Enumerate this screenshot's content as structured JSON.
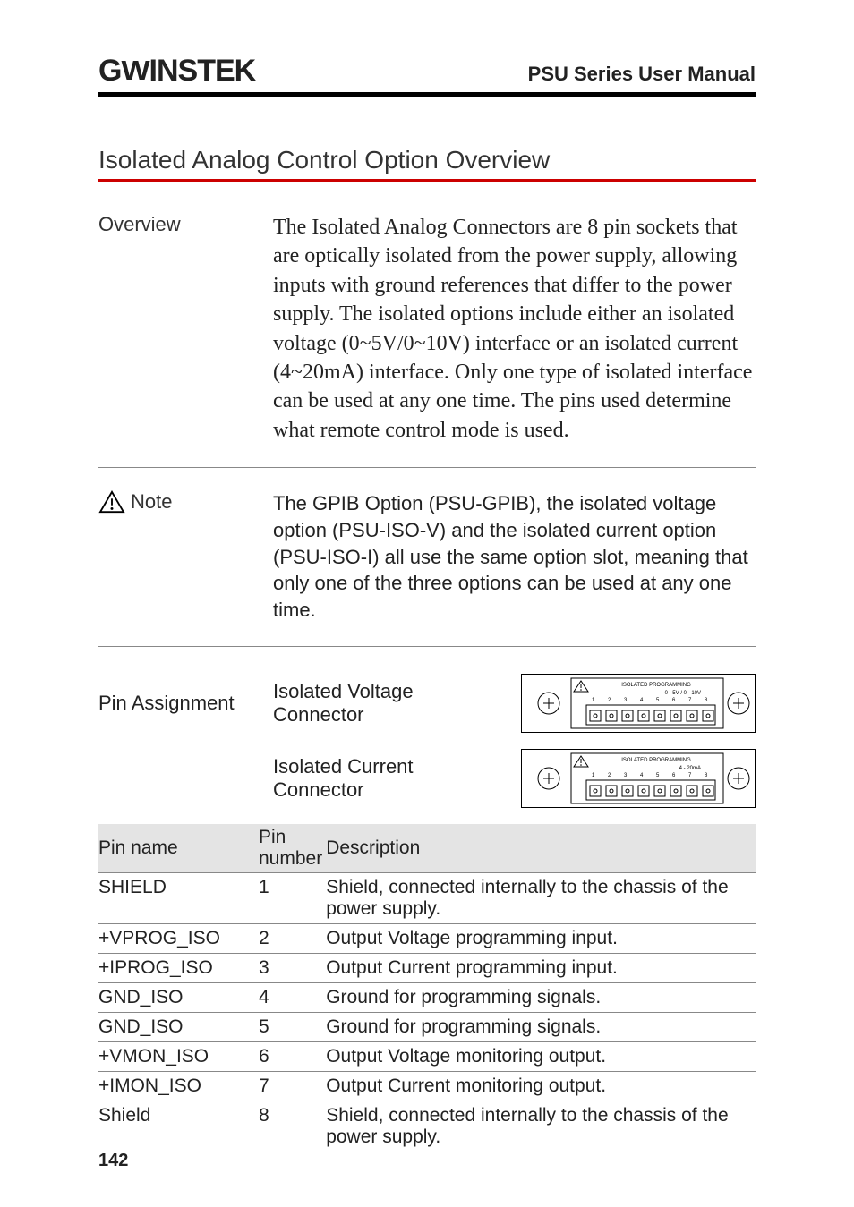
{
  "header": {
    "brand": "GWINSTEK",
    "doc_title": "PSU Series User Manual"
  },
  "section_title": "Isolated Analog Control Option Overview",
  "overview": {
    "label": "Overview",
    "text": "The Isolated Analog Connectors are 8 pin sockets that are optically isolated from the power supply, allowing inputs with ground references that differ to the power supply. The isolated options include either an isolated voltage (0~5V/0~10V) interface or an isolated current (4~20mA) interface. Only one type of isolated interface can be used at any one time. The pins used determine what remote control mode is used."
  },
  "note": {
    "label": "Note",
    "text": "The GPIB Option (PSU-GPIB), the isolated voltage option (PSU-ISO-V) and the isolated current option (PSU-ISO-I) all use the same option slot, meaning that only one of the three options can be used at any one time."
  },
  "pin_assignment": {
    "label": "Pin Assignment",
    "voltage_label": "Isolated Voltage Connector",
    "current_label": "Isolated Current Connector",
    "voltage_conn_title": "ISOLATED PROGRAMMING",
    "voltage_conn_sub": "0 - 5V / 0 - 10V",
    "current_conn_title": "ISOLATED PROGRAMMING",
    "current_conn_sub": "4 - 20mA"
  },
  "pin_table": {
    "headers": {
      "name": "Pin name",
      "num": "Pin number",
      "desc": "Description"
    },
    "rows": [
      {
        "name": "SHIELD",
        "num": "1",
        "desc": "Shield, connected internally to the chassis of the power supply."
      },
      {
        "name": "+VPROG_ISO",
        "num": "2",
        "desc": "Output Voltage programming input."
      },
      {
        "name": "+IPROG_ISO",
        "num": "3",
        "desc": "Output Current programming input."
      },
      {
        "name": "GND_ISO",
        "num": "4",
        "desc": "Ground for programming signals."
      },
      {
        "name": "GND_ISO",
        "num": "5",
        "desc": "Ground for programming signals."
      },
      {
        "name": "+VMON_ISO",
        "num": "6",
        "desc": "Output Voltage monitoring output."
      },
      {
        "name": "+IMON_ISO",
        "num": "7",
        "desc": "Output Current monitoring output."
      },
      {
        "name": "Shield",
        "num": "8",
        "desc": "Shield, connected internally to the chassis of the power supply."
      }
    ]
  },
  "page_number": "142"
}
